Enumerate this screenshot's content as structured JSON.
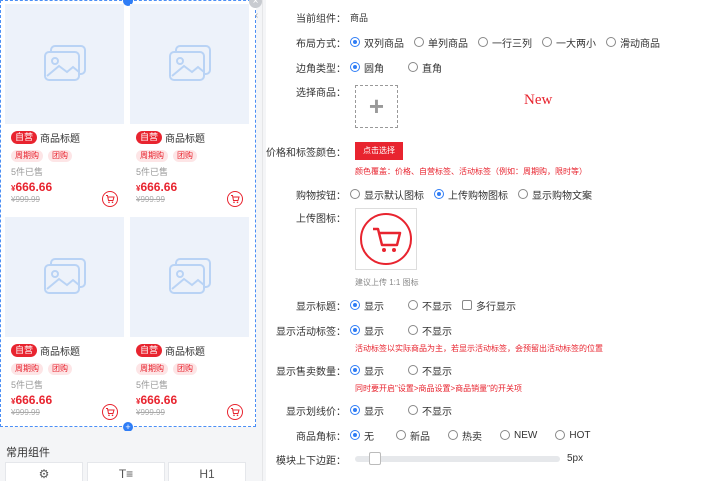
{
  "preview": {
    "cards": [
      {
        "tag": "自营",
        "title": "商品标题",
        "promos": [
          "周期购",
          "团购"
        ],
        "sold": "5件已售",
        "price_symbol": "¥",
        "price": "666.66",
        "orig": "¥999.99"
      },
      {
        "tag": "自营",
        "title": "商品标题",
        "promos": [
          "周期购",
          "团购"
        ],
        "sold": "5件已售",
        "price_symbol": "¥",
        "price": "666.66",
        "orig": "¥999.99"
      },
      {
        "tag": "自营",
        "title": "商品标题",
        "promos": [
          "周期购",
          "团购"
        ],
        "sold": "5件已售",
        "price_symbol": "¥",
        "price": "666.66",
        "orig": "¥999.99"
      },
      {
        "tag": "自营",
        "title": "商品标题",
        "promos": [
          "周期购",
          "团购"
        ],
        "sold": "5件已售",
        "price_symbol": "¥",
        "price": "666.66",
        "orig": "¥999.99"
      }
    ],
    "close_glyph": "×"
  },
  "components": {
    "title": "常用组件",
    "tiles": [
      "⚙",
      "T≡",
      "H1"
    ]
  },
  "settings": {
    "current_label": "当前组件：",
    "current_value": "商品",
    "layout_label": "布局方式：",
    "layout_options": [
      "双列商品",
      "单列商品",
      "一行三列",
      "一大两小",
      "滑动商品"
    ],
    "corner_label": "边角类型：",
    "corner_options": [
      "圆角",
      "直角"
    ],
    "select_label": "选择商品：",
    "add_glyph": "+",
    "new_text": "New",
    "color_label": "价格和标签颜色：",
    "color_button": "点击选择",
    "color_hint": "颜色覆盖：价格、自营标签、活动标签（例如：周期购，限时等）",
    "cart_label": "购物按钮：",
    "cart_options": [
      "显示默认图标",
      "上传购物图标",
      "显示购物文案"
    ],
    "upload_label": "上传图标：",
    "upload_hint": "建议上传 1:1 图标",
    "show_title_label": "显示标题：",
    "show_title_options": [
      "显示",
      "不显示"
    ],
    "multiline_label": "多行显示",
    "activity_label": "显示活动标签：",
    "activity_options": [
      "显示",
      "不显示"
    ],
    "activity_hint": "活动标签以实际商品为主，若显示活动标签，会预留出活动标签的位置",
    "sales_label": "显示售卖数量：",
    "sales_options": [
      "显示",
      "不显示"
    ],
    "sales_hint": "同时要开启\"设置>商品设置>商品销量\"的开关项",
    "strike_label": "显示划线价：",
    "strike_options": [
      "显示",
      "不显示"
    ],
    "badge_label": "商品角标：",
    "badge_options": [
      "无",
      "新品",
      "热卖",
      "NEW",
      "HOT"
    ],
    "margin_label": "模块上下边距：",
    "margin_value": "5px",
    "margin_level": 5
  }
}
